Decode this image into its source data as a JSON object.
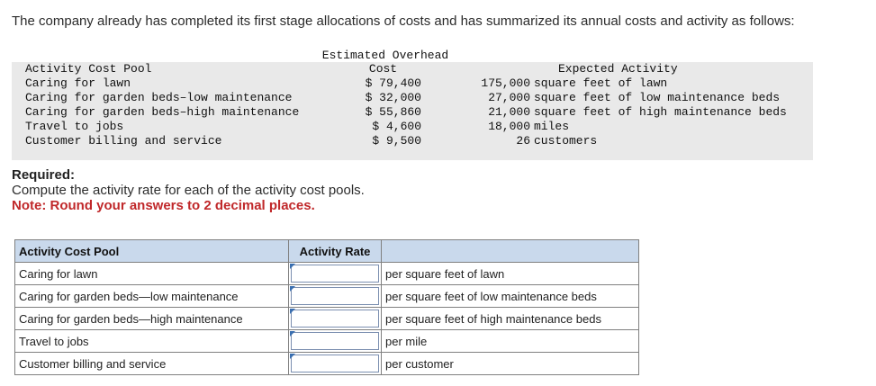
{
  "intro": "The company already has completed its first stage allocations of costs and has summarized its annual costs and activity as follows:",
  "summary": {
    "header_overhead_line1": "Estimated Overhead",
    "header_pool": "Activity Cost Pool",
    "header_overhead_line2": "Cost",
    "header_activity": "Expected Activity",
    "rows": [
      {
        "pool": "Caring for lawn",
        "cost": "$ 79,400",
        "qty": "175,000",
        "unit": "square feet of lawn"
      },
      {
        "pool": "Caring for garden beds–low maintenance",
        "cost": "$ 32,000",
        "qty": "27,000",
        "unit": "square feet of low maintenance beds"
      },
      {
        "pool": "Caring for garden beds–high maintenance",
        "cost": "$ 55,860",
        "qty": "21,000",
        "unit": "square feet of high maintenance beds"
      },
      {
        "pool": "Travel to jobs",
        "cost": "$ 4,600",
        "qty": "18,000",
        "unit": "miles"
      },
      {
        "pool": "Customer billing and service",
        "cost": "$ 9,500",
        "qty": "26",
        "unit": "customers"
      }
    ]
  },
  "required": {
    "heading": "Required:",
    "task": "Compute the activity rate for each of the activity cost pools.",
    "note": "Note: Round your answers to 2 decimal places."
  },
  "answer_table": {
    "col_pool": "Activity Cost Pool",
    "col_rate": "Activity Rate",
    "rows": [
      {
        "pool": "Caring for lawn",
        "unit": "per square feet of lawn",
        "value": ""
      },
      {
        "pool": "Caring for garden beds—low maintenance",
        "unit": "per square feet of low maintenance beds",
        "value": ""
      },
      {
        "pool": "Caring for garden beds—high maintenance",
        "unit": "per square feet of high maintenance beds",
        "value": ""
      },
      {
        "pool": "Travel to jobs",
        "unit": "per mile",
        "value": ""
      },
      {
        "pool": "Customer billing and service",
        "unit": "per customer",
        "value": ""
      }
    ]
  }
}
